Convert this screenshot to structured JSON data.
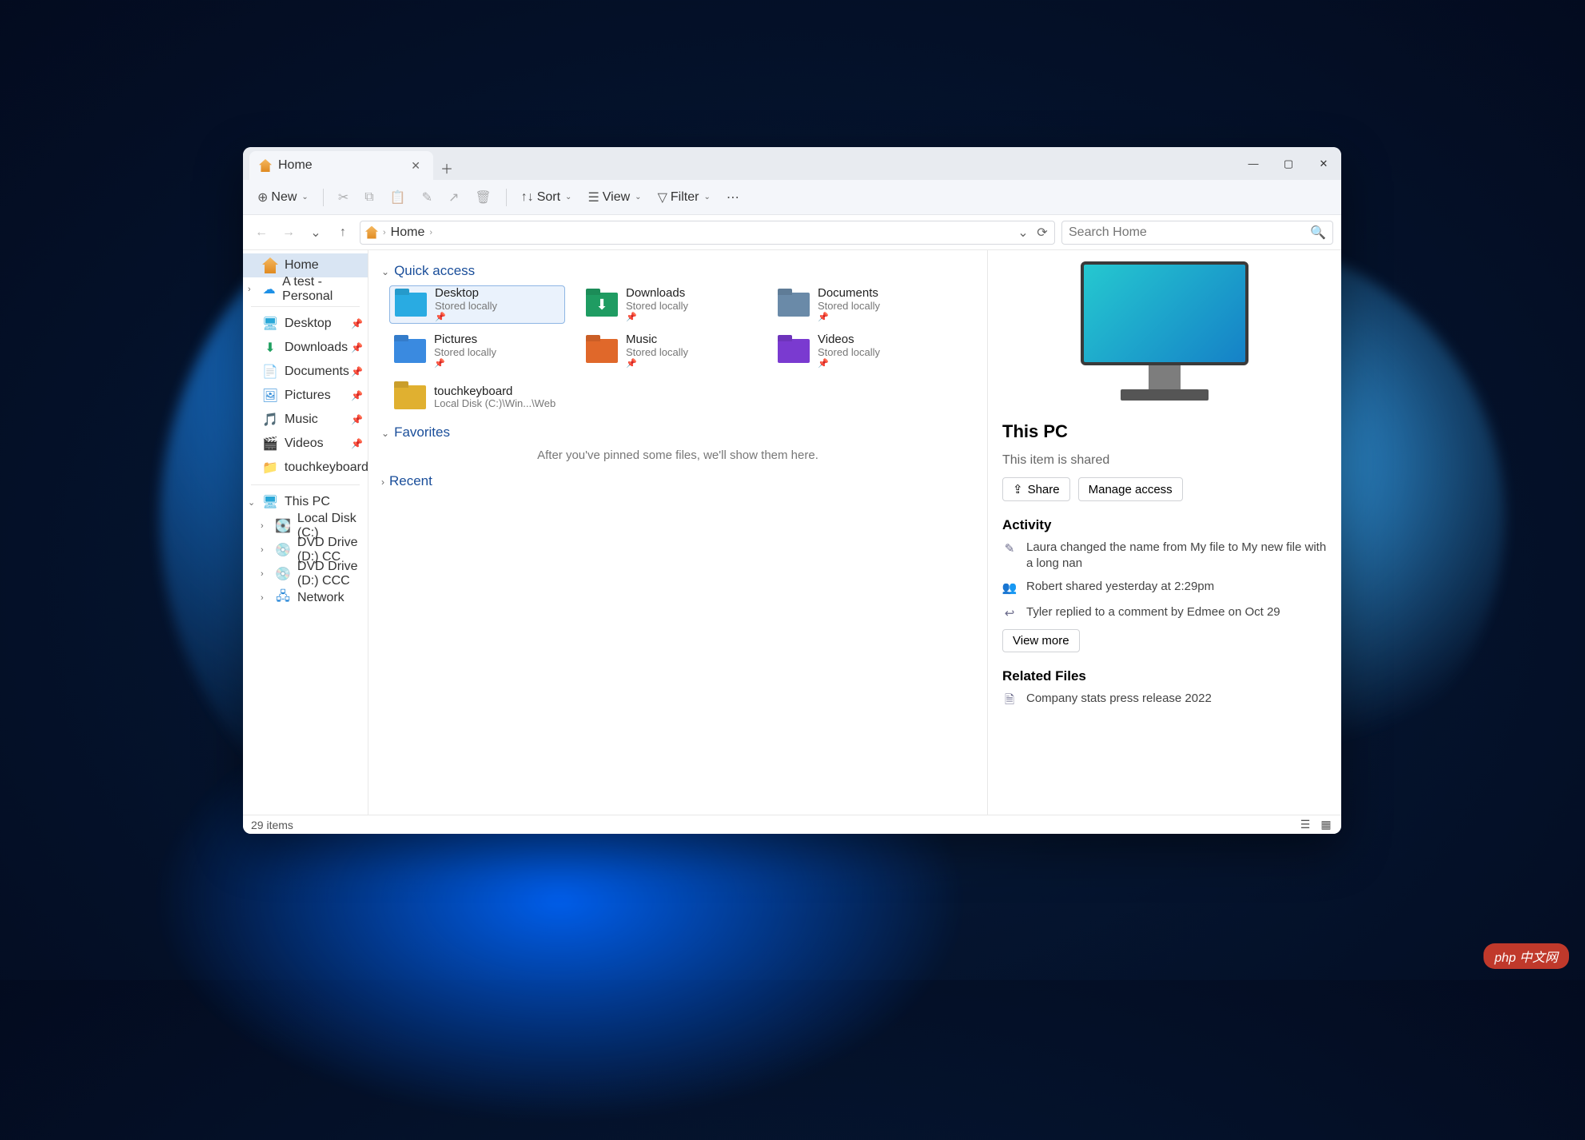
{
  "tab": {
    "title": "Home"
  },
  "toolbar": {
    "new": "New",
    "sort": "Sort",
    "view": "View",
    "filter": "Filter"
  },
  "nav": {
    "crumb": "Home",
    "refresh_title": "Refresh"
  },
  "search": {
    "placeholder": "Search Home"
  },
  "sidebar": {
    "home": "Home",
    "personal": "A test - Personal",
    "desktop": "Desktop",
    "downloads": "Downloads",
    "documents": "Documents",
    "pictures": "Pictures",
    "music": "Music",
    "videos": "Videos",
    "touchkeyboard": "touchkeyboard",
    "this_pc": "This PC",
    "localdisk": "Local Disk (C:)",
    "dvd1": "DVD Drive (D:) CC",
    "dvd2": "DVD Drive (D:) CCC",
    "network": "Network"
  },
  "sections": {
    "quick_access": "Quick access",
    "favorites": "Favorites",
    "recent": "Recent",
    "favorites_empty": "After you've pinned some files, we'll show them here."
  },
  "qa": {
    "desktop": {
      "t": "Desktop",
      "s": "Stored locally"
    },
    "downloads": {
      "t": "Downloads",
      "s": "Stored locally"
    },
    "documents": {
      "t": "Documents",
      "s": "Stored locally"
    },
    "pictures": {
      "t": "Pictures",
      "s": "Stored locally"
    },
    "music": {
      "t": "Music",
      "s": "Stored locally"
    },
    "videos": {
      "t": "Videos",
      "s": "Stored locally"
    },
    "touchkeyboard": {
      "t": "touchkeyboard",
      "s": "Local Disk (C:)\\Win...\\Web"
    }
  },
  "details": {
    "title": "This PC",
    "shared": "This item is shared",
    "share_btn": "Share",
    "manage_btn": "Manage access",
    "activity": "Activity",
    "a1": "Laura changed the name from My file to My new file with a long nan",
    "a2": "Robert shared yesterday at 2:29pm",
    "a3": "Tyler replied to a comment by Edmee on Oct 29",
    "view_more": "View more",
    "related": "Related Files",
    "r1": "Company stats press release 2022"
  },
  "status": {
    "count": "29 items"
  },
  "watermark": "php 中文网"
}
